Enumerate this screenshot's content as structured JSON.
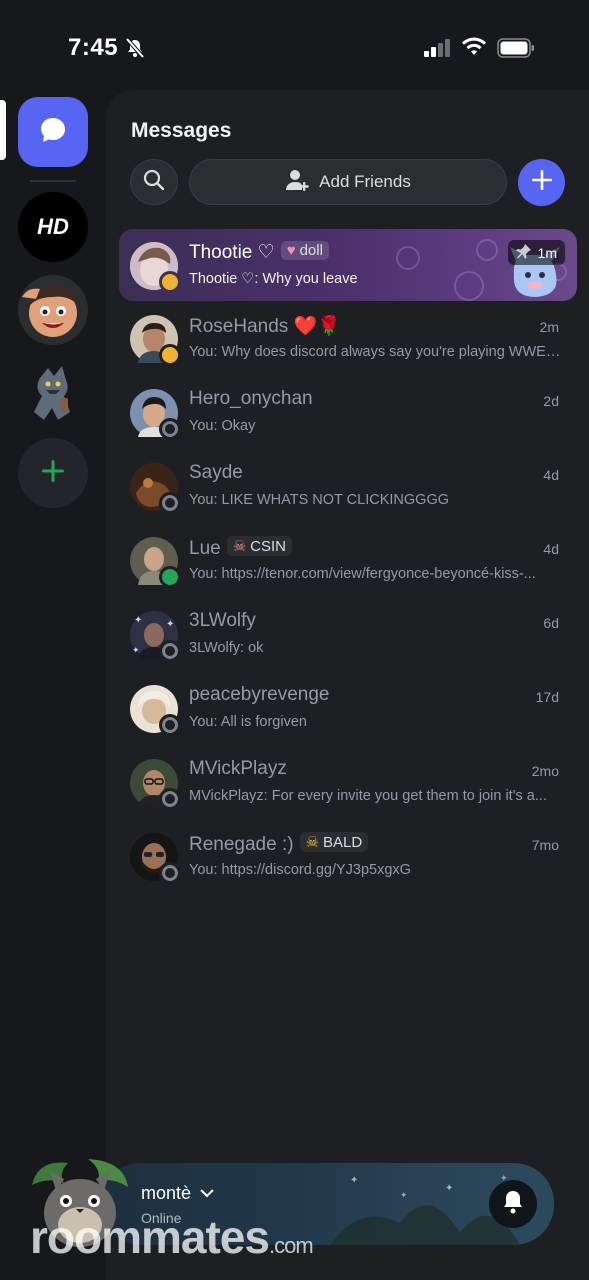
{
  "status_bar": {
    "time": "7:45"
  },
  "header": {
    "title": "Messages",
    "add_friends_label": "Add Friends"
  },
  "servers": [
    {
      "name": "direct-messages"
    },
    {
      "name": "HD",
      "label": "HD"
    },
    {
      "name": "cartoon-face"
    },
    {
      "name": "figure"
    }
  ],
  "dms": [
    {
      "name": "Thootie ♡",
      "tag": "doll",
      "tag_icon": "heart-icon",
      "preview": "Thootie ♡: Why you leave",
      "time": "1m",
      "status": "idle",
      "pinned": true,
      "active": true,
      "avatar_color": "#cfc6d6"
    },
    {
      "name": "RoseHands",
      "emoji": "❤️🌹",
      "preview": "You: Why does discord always say you're playing WWE?...",
      "time": "2m",
      "status": "idle",
      "avatar_color": "#8a7a6a"
    },
    {
      "name": "Hero_onychan",
      "preview": "You: Okay",
      "time": "2d",
      "status": "offline",
      "avatar_color": "#6a7d9a"
    },
    {
      "name": "Sayde",
      "preview": "You: LIKE WHATS NOT CLICKINGGGG",
      "time": "4d",
      "status": "offline",
      "avatar_color": "#5a3a2a"
    },
    {
      "name": "Lue",
      "tag": "CSIN",
      "tag_icon": "skull-icon",
      "preview": "You: https://tenor.com/view/fergyonce-beyoncé-kiss-...",
      "time": "4d",
      "status": "online",
      "avatar_color": "#6b6a5a"
    },
    {
      "name": "3LWolfy",
      "preview": "3LWolfy: ok",
      "time": "6d",
      "status": "offline",
      "avatar_color": "#3a3a50"
    },
    {
      "name": "peacebyrevenge",
      "preview": "You: All is forgiven",
      "time": "17d",
      "status": "offline",
      "avatar_color": "#d8d2c4"
    },
    {
      "name": "MVickPlayz",
      "preview": "MVickPlayz: For every invite you get them to join it's a...",
      "time": "2mo",
      "status": "offline",
      "avatar_color": "#4a5a4a"
    },
    {
      "name": "Renegade :)",
      "tag": "BALD",
      "tag_icon": "skull-icon",
      "preview": "You: https://discord.gg/YJ3p5xgxG",
      "time": "7mo",
      "status": "offline",
      "avatar_color": "#2a2a2a"
    }
  ],
  "user": {
    "name": "montè",
    "status": "Online"
  },
  "watermark": {
    "main": "roommates",
    "suffix": ".com"
  },
  "colors": {
    "accent": "#5865f2",
    "online": "#23a55a",
    "idle": "#f0b232",
    "offline": "#80848e"
  }
}
